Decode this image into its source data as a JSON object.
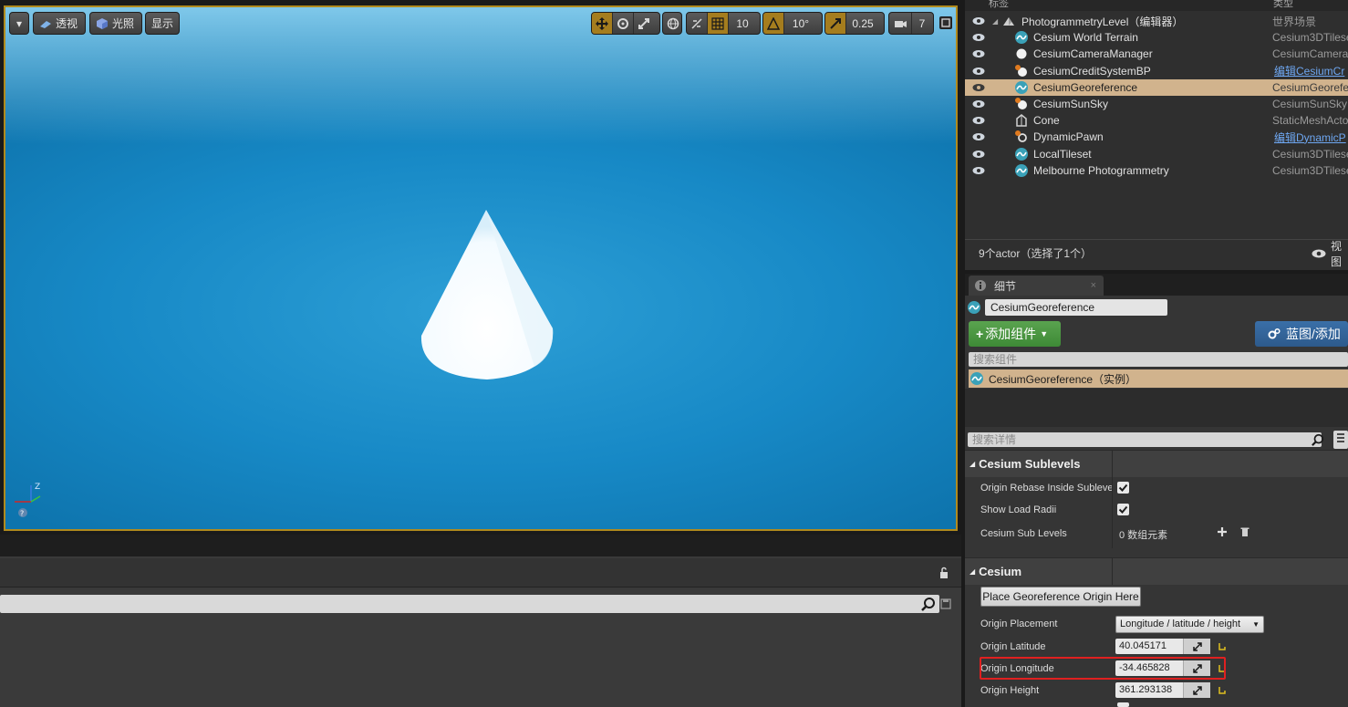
{
  "viewport": {
    "menu_arrow": "▾",
    "perspective_label": "透视",
    "lit_label": "光照",
    "show_label": "显示",
    "grid_snap_value": "10",
    "rotation_snap_value": "10°",
    "scale_snap_value": "0.25",
    "camera_speed_value": "7",
    "axis_z": "Z",
    "axis_help": "?",
    "accent_color": "#a57d1e"
  },
  "outliner": {
    "col_label": "标签",
    "col_type": "类型",
    "rows": [
      {
        "name": "PhotogrammetryLevel（编辑器）",
        "type": "世界场景",
        "icon": "world-icon"
      },
      {
        "name": "Cesium World Terrain",
        "type": "Cesium3DTilese",
        "icon": "cesium-icon"
      },
      {
        "name": "CesiumCameraManager",
        "type": "CesiumCamera",
        "icon": "sphere-icon"
      },
      {
        "name": "CesiumCreditSystemBP",
        "type": "编辑CesiumCr",
        "icon": "blueprint-icon"
      },
      {
        "name": "CesiumGeoreference",
        "type": "CesiumGeorefe",
        "icon": "cesium-icon"
      },
      {
        "name": "CesiumSunSky",
        "type": "CesiumSunSky",
        "icon": "blueprint-icon"
      },
      {
        "name": "Cone",
        "type": "StaticMeshActo",
        "icon": "mesh-icon"
      },
      {
        "name": "DynamicPawn",
        "type": "编辑DynamicP",
        "icon": "pawn-icon"
      },
      {
        "name": "LocalTileset",
        "type": "Cesium3DTilese",
        "icon": "cesium-icon"
      },
      {
        "name": "Melbourne Photogrammetry",
        "type": "Cesium3DTilese",
        "icon": "cesium-icon"
      }
    ],
    "footer_count": "9个actor（选择了1个）",
    "view_options_label": "视图"
  },
  "details": {
    "tab_label": "细节",
    "tab_close": "×",
    "actor_name": "CesiumGeoreference",
    "add_component_label": "添加组件",
    "blueprint_label": "蓝图/添加",
    "search_components_placeholder": "搜索组件",
    "component_instance": "CesiumGeoreference（实例）",
    "search_details_placeholder": "搜索详情",
    "sublevels_section": "Cesium Sublevels",
    "origin_rebase_label": "Origin Rebase Inside Sublevels",
    "origin_rebase_checked": true,
    "show_load_radii_label": "Show Load Radii",
    "show_load_radii_checked": true,
    "sub_levels_label": "Cesium Sub Levels",
    "sub_levels_value": "0 数组元素",
    "cesium_section": "Cesium",
    "place_origin_button": "Place Georeference Origin Here",
    "origin_placement_label": "Origin Placement",
    "origin_placement_value": "Longitude / latitude / height",
    "origin_latitude_label": "Origin Latitude",
    "origin_latitude_value": "40.045171",
    "origin_longitude_label": "Origin Longitude",
    "origin_longitude_value": "-34.465828",
    "origin_height_label": "Origin Height",
    "origin_height_value": "361.293138",
    "highlight_color": "#e02020"
  }
}
